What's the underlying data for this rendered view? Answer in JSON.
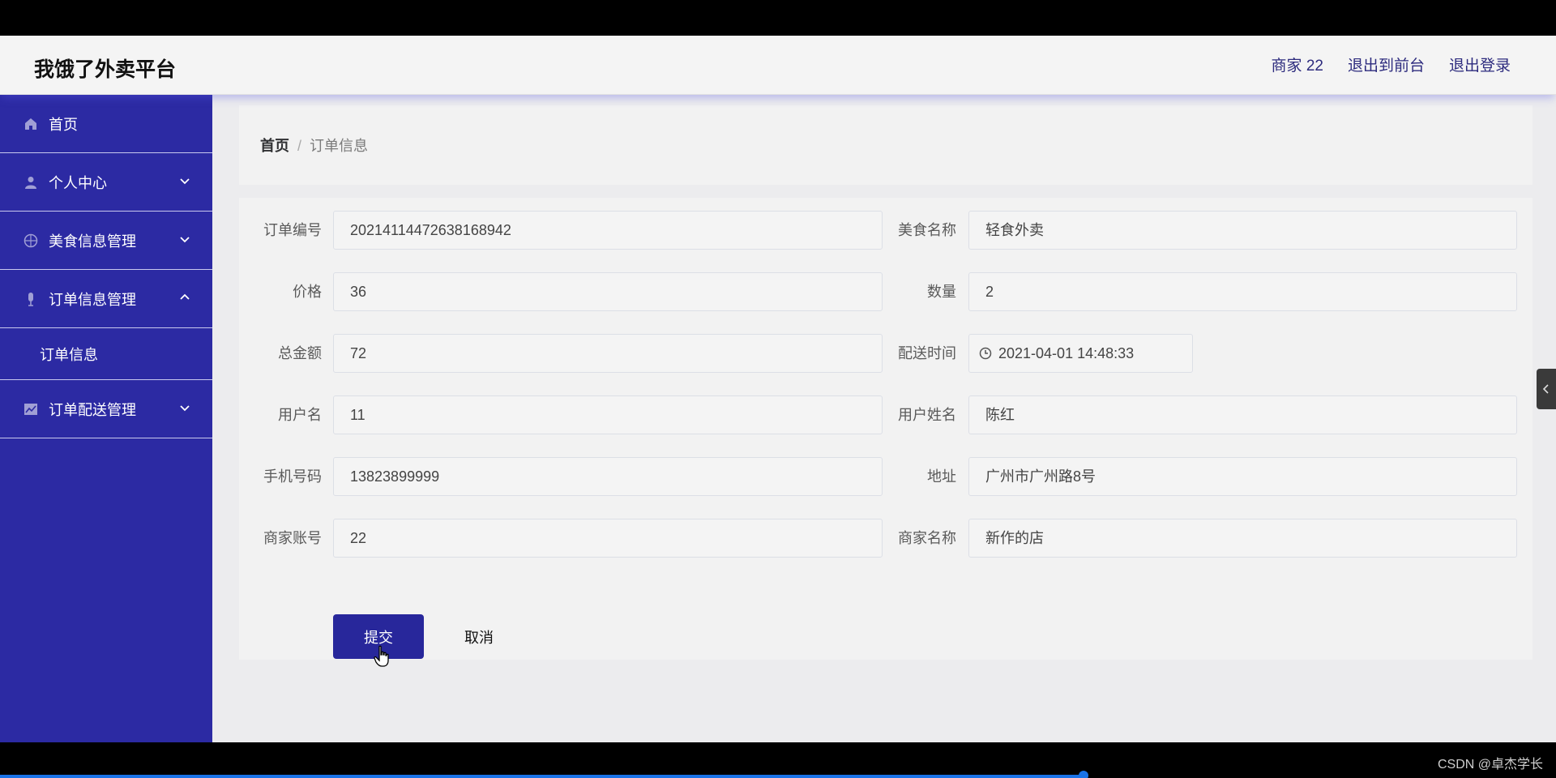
{
  "app": {
    "brand": "我饿了外卖平台",
    "header_links": [
      "商家 22",
      "退出到前台",
      "退出登录"
    ]
  },
  "sidebar": {
    "items": [
      {
        "label": "首页",
        "icon": "home-icon"
      },
      {
        "label": "个人中心",
        "icon": "user-icon",
        "expanded": false
      },
      {
        "label": "美食信息管理",
        "icon": "aperture-icon",
        "expanded": false
      },
      {
        "label": "订单信息管理",
        "icon": "microphone-icon",
        "expanded": true,
        "children": [
          "订单信息"
        ]
      },
      {
        "label": "订单配送管理",
        "icon": "chart-icon",
        "expanded": false
      }
    ]
  },
  "breadcrumb": {
    "home": "首页",
    "separator": "/",
    "current": "订单信息"
  },
  "form": {
    "rows": [
      {
        "left": {
          "label": "订单编号",
          "value": "20214114472638168942"
        },
        "right": {
          "label": "美食名称",
          "value": "轻食外卖"
        }
      },
      {
        "left": {
          "label": "价格",
          "value": "36"
        },
        "right": {
          "label": "数量",
          "value": "2"
        }
      },
      {
        "left": {
          "label": "总金额",
          "value": "72"
        },
        "right": {
          "label": "配送时间",
          "value": "2021-04-01 14:48:33"
        }
      },
      {
        "left": {
          "label": "用户名",
          "value": "11"
        },
        "right": {
          "label": "用户姓名",
          "value": "陈红"
        }
      },
      {
        "left": {
          "label": "手机号码",
          "value": "13823899999"
        },
        "right": {
          "label": "地址",
          "value": "广州市广州路8号"
        }
      },
      {
        "left": {
          "label": "商家账号",
          "value": "22"
        },
        "right": {
          "label": "商家名称",
          "value": "新作的店"
        }
      }
    ],
    "submit_label": "提交",
    "cancel_label": "取消"
  },
  "watermark": "CSDN @卓杰学长",
  "colors": {
    "sidebar": "#2c2aa3",
    "primary_button": "#28279b",
    "header_link": "#2d2b7e"
  }
}
